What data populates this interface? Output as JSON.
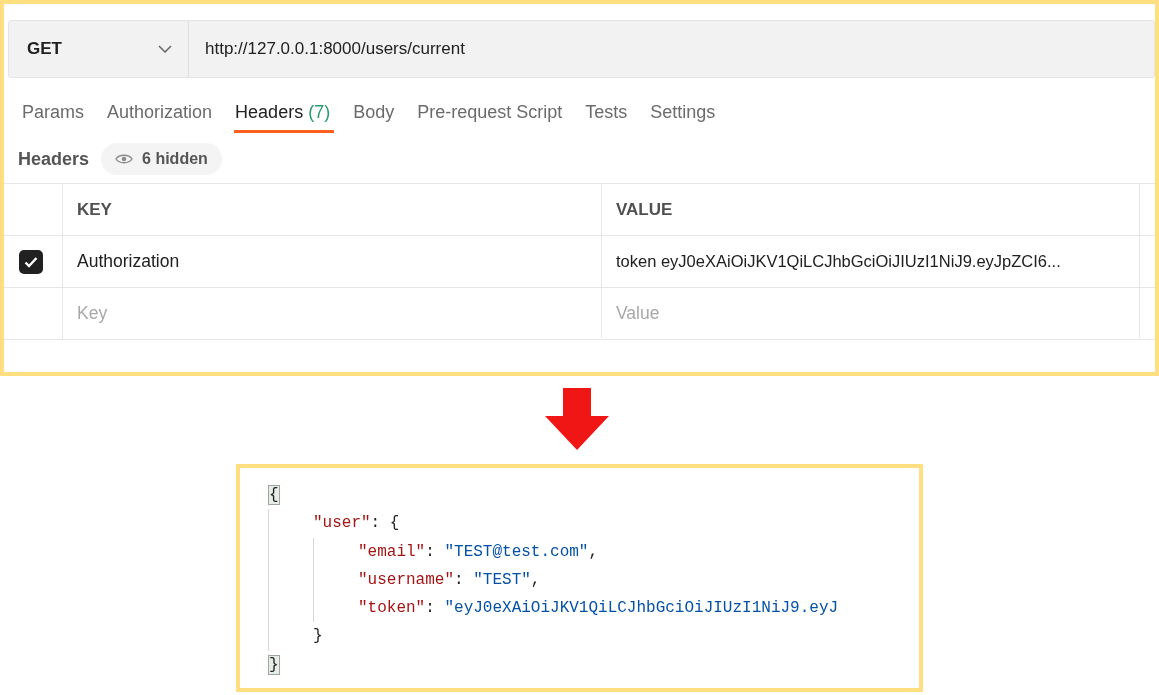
{
  "request": {
    "method": "GET",
    "url": "http://127.0.0.1:8000/users/current"
  },
  "tabs": [
    {
      "label": "Params",
      "selected": false
    },
    {
      "label": "Authorization",
      "selected": false
    },
    {
      "label": "Headers",
      "count": "(7)",
      "selected": true
    },
    {
      "label": "Body",
      "selected": false
    },
    {
      "label": "Pre-request Script",
      "selected": false
    },
    {
      "label": "Tests",
      "selected": false
    },
    {
      "label": "Settings",
      "selected": false
    }
  ],
  "headers_bar": {
    "label": "Headers",
    "hidden_badge": "6 hidden"
  },
  "table": {
    "columns": [
      "KEY",
      "VALUE"
    ],
    "rows": [
      {
        "checked": true,
        "key": "Authorization",
        "value": "token eyJ0eXAiOiJKV1QiLCJhbGciOiJIUzI1NiJ9.eyJpZCI6..."
      }
    ],
    "new_row": {
      "key_placeholder": "Key",
      "value_placeholder": "Value"
    }
  },
  "response": {
    "line": [
      {
        "kind": "match",
        "text": "{"
      }
    ],
    "children": [
      {
        "line": [
          {
            "kind": "key",
            "text": "\"user\""
          },
          {
            "kind": "punct",
            "text": ": {"
          }
        ],
        "children": [
          {
            "line": [
              {
                "kind": "key",
                "text": "\"email\""
              },
              {
                "kind": "punct",
                "text": ": "
              },
              {
                "kind": "string",
                "text": "\"TEST@test.com\""
              },
              {
                "kind": "punct",
                "text": ","
              }
            ]
          },
          {
            "line": [
              {
                "kind": "key",
                "text": "\"username\""
              },
              {
                "kind": "punct",
                "text": ": "
              },
              {
                "kind": "string",
                "text": "\"TEST\""
              },
              {
                "kind": "punct",
                "text": ","
              }
            ]
          },
          {
            "line": [
              {
                "kind": "key",
                "text": "\"token\""
              },
              {
                "kind": "punct",
                "text": ": "
              },
              {
                "kind": "string",
                "text": "\"eyJ0eXAiOiJKV1QiLCJhbGciOiJIUzI1NiJ9.eyJ"
              }
            ]
          }
        ],
        "end": [
          {
            "kind": "punct",
            "text": "}"
          }
        ]
      }
    ],
    "end": [
      {
        "kind": "match",
        "text": "}"
      }
    ]
  }
}
